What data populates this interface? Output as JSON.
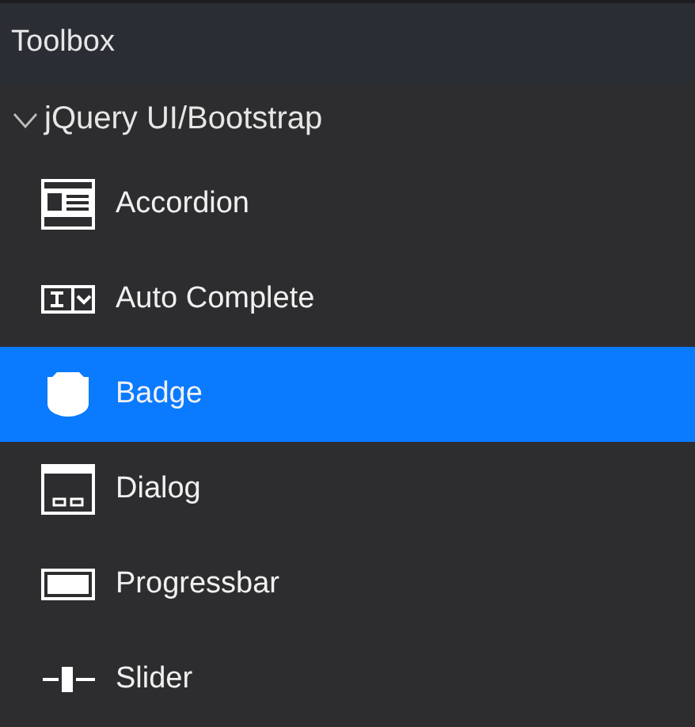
{
  "panel": {
    "title": "Toolbox"
  },
  "group": {
    "label": "jQuery UI/Bootstrap",
    "expanded": true,
    "items": [
      {
        "label": "Accordion",
        "kind": "accordion",
        "selected": false
      },
      {
        "label": "Auto Complete",
        "kind": "autocomplete",
        "selected": false
      },
      {
        "label": "Badge",
        "kind": "badge",
        "selected": true
      },
      {
        "label": "Dialog",
        "kind": "dialog",
        "selected": false
      },
      {
        "label": "Progressbar",
        "kind": "progressbar",
        "selected": false
      },
      {
        "label": "Slider",
        "kind": "slider",
        "selected": false
      }
    ]
  }
}
